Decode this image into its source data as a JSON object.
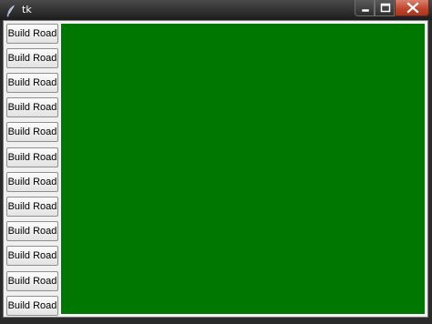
{
  "window": {
    "title": "tk"
  },
  "buttons": [
    {
      "label": "Build Road"
    },
    {
      "label": "Build Road"
    },
    {
      "label": "Build Road"
    },
    {
      "label": "Build Road"
    },
    {
      "label": "Build Road"
    },
    {
      "label": "Build Road"
    },
    {
      "label": "Build Road"
    },
    {
      "label": "Build Road"
    },
    {
      "label": "Build Road"
    },
    {
      "label": "Build Road"
    },
    {
      "label": "Build Road"
    },
    {
      "label": "Build Road"
    }
  ],
  "colors": {
    "canvas": "#007700",
    "client_background": "#f0f0f0",
    "close_button": "#c0462e"
  },
  "icons": {
    "app": "feather-icon",
    "minimize": "minimize-icon",
    "maximize": "maximize-icon",
    "close": "close-icon"
  }
}
